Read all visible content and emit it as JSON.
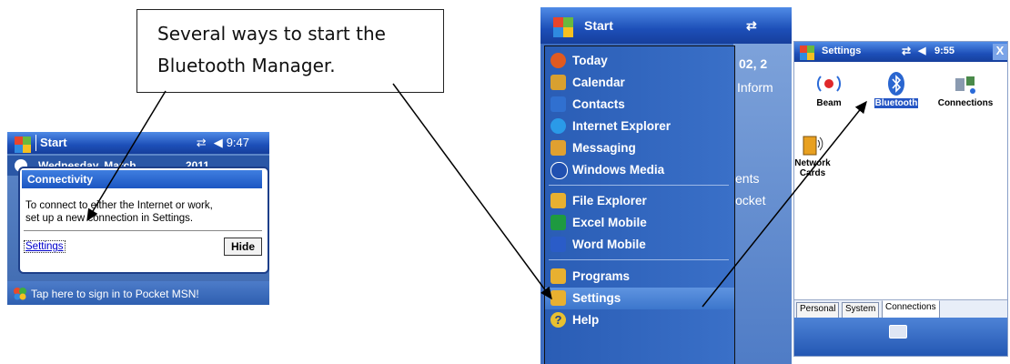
{
  "callout": {
    "line1": "Several ways to start the",
    "line2": "Bluetooth Manager."
  },
  "screen1": {
    "title": "Start",
    "time": "9:47",
    "date_left": "Wednesday, March",
    "date_right": "2011",
    "bubble_title": "Connectivity",
    "bubble_text_1": "To connect to either the Internet or work,",
    "bubble_text_2": "set up a new connection in Settings.",
    "settings_link": "Settings",
    "hide_button": "Hide",
    "tap_text": "Tap here to sign in to Pocket MSN!"
  },
  "screen2": {
    "title": "Start",
    "behind_text": [
      "02, 2",
      "Inform",
      "ents",
      "ocket"
    ],
    "menu": [
      {
        "label": "Today",
        "icon": "today-icon",
        "color": "#e05a20"
      },
      {
        "label": "Calendar",
        "icon": "calendar-icon",
        "color": "#d8a030"
      },
      {
        "label": "Contacts",
        "icon": "contacts-icon",
        "color": "#3070d0"
      },
      {
        "label": "Internet Explorer",
        "icon": "internet-explorer-icon",
        "color": "#2a9ae8"
      },
      {
        "label": "Messaging",
        "icon": "messaging-icon",
        "color": "#e0a030"
      },
      {
        "label": "Windows Media",
        "icon": "windows-media-icon",
        "color": "#2050b0"
      },
      {
        "label": "File Explorer",
        "icon": "file-explorer-icon",
        "color": "#e8b030"
      },
      {
        "label": "Excel Mobile",
        "icon": "excel-mobile-icon",
        "color": "#1e9a40"
      },
      {
        "label": "Word Mobile",
        "icon": "word-mobile-icon",
        "color": "#2a5cc8"
      },
      {
        "label": "Programs",
        "icon": "programs-icon",
        "color": "#e8b030"
      },
      {
        "label": "Settings",
        "icon": "settings-icon",
        "color": "#e8b030"
      },
      {
        "label": "Help",
        "icon": "help-icon",
        "color": "#e8c030"
      }
    ]
  },
  "screen3": {
    "title": "Settings",
    "time": "9:55",
    "close": "X",
    "icons": [
      {
        "label": "Beam"
      },
      {
        "label": "Bluetooth"
      },
      {
        "label": "Connections"
      },
      {
        "label": "Network Cards"
      }
    ],
    "tabs": [
      "Personal",
      "System",
      "Connections"
    ]
  }
}
